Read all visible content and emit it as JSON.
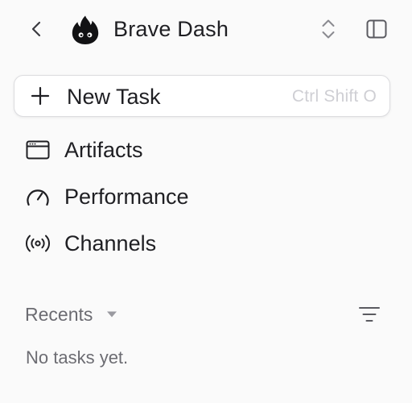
{
  "header": {
    "title": "Brave Dash",
    "back_icon": "chevron-left-icon",
    "logo_icon": "flame-logo-icon",
    "switcher_icon": "chevron-up-down-icon",
    "sidebar_icon": "sidebar-panel-icon"
  },
  "new_task": {
    "label": "New Task",
    "shortcut": "Ctrl Shift O",
    "icon": "plus-icon"
  },
  "nav": {
    "items": [
      {
        "label": "Artifacts",
        "icon": "browser-window-icon"
      },
      {
        "label": "Performance",
        "icon": "gauge-icon"
      },
      {
        "label": "Channels",
        "icon": "broadcast-icon"
      }
    ]
  },
  "recents": {
    "label": "Recents",
    "caret_icon": "caret-down-icon",
    "filter_icon": "filter-lines-icon",
    "empty_text": "No tasks yet."
  },
  "colors": {
    "background": "#fafafa",
    "text_primary": "#1f1f23",
    "text_muted": "#6c6c72",
    "shortcut_text": "#cfcfd4",
    "border": "#dcdcdf"
  }
}
